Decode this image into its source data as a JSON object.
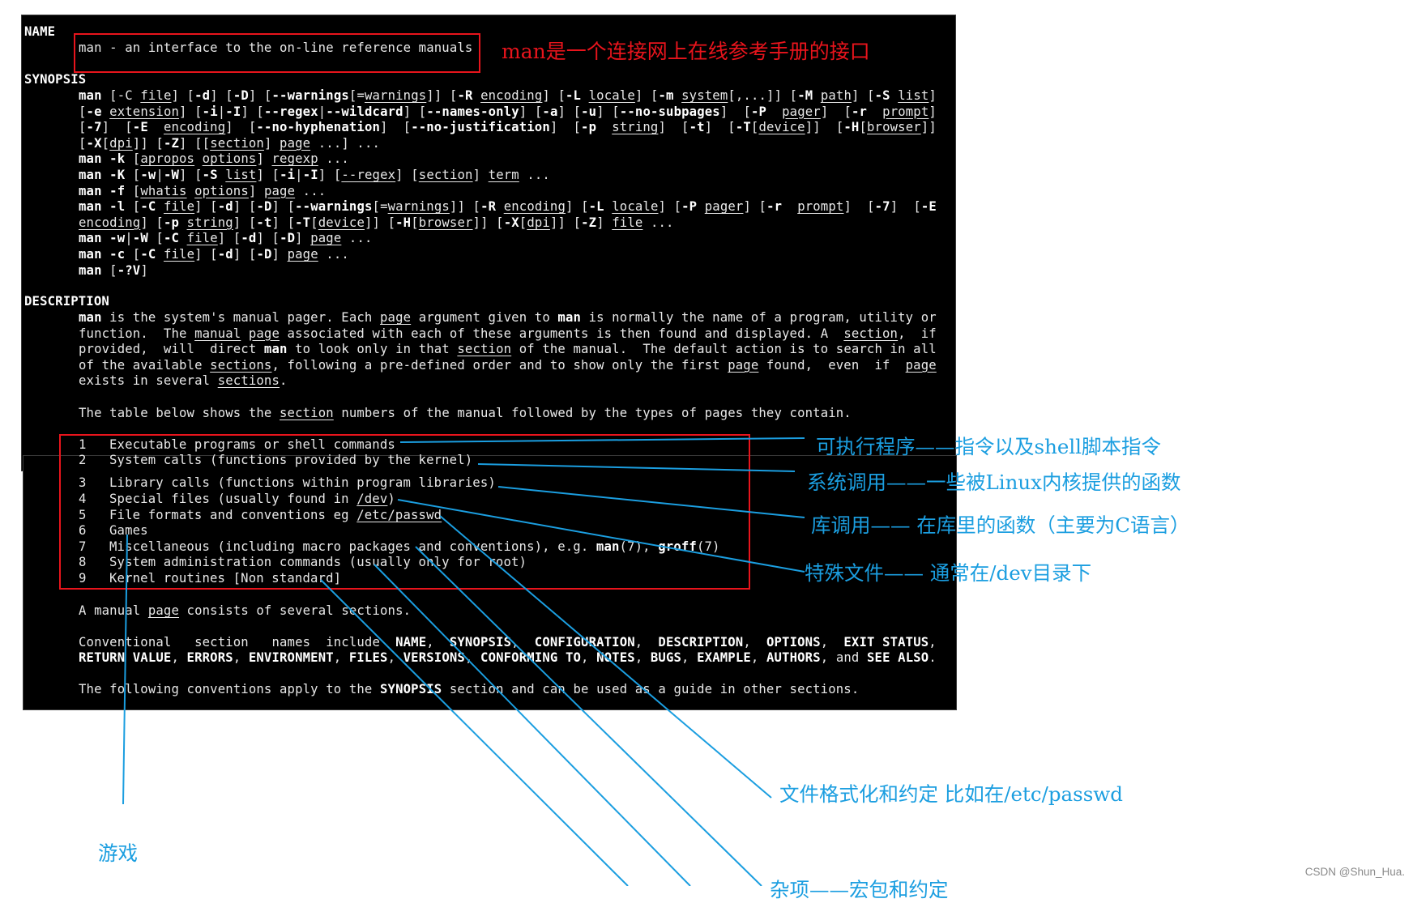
{
  "man_page": {
    "name_header": "NAME",
    "name_line": "man - an interface to the on-line reference manuals",
    "synopsis_header": "SYNOPSIS",
    "synopsis_lines": [
      [
        [
          "b",
          "man"
        ],
        [
          "t",
          " [-C "
        ],
        [
          "u",
          "file"
        ],
        [
          "t",
          "] ["
        ],
        [
          "b",
          "-d"
        ],
        [
          "t",
          "] ["
        ],
        [
          "b",
          "-D"
        ],
        [
          "t",
          "] ["
        ],
        [
          "b",
          "--warnings"
        ],
        [
          "t",
          "[="
        ],
        [
          "u",
          "warnings"
        ],
        [
          "t",
          "]] ["
        ],
        [
          "b",
          "-R"
        ],
        [
          "t",
          " "
        ],
        [
          "u",
          "encoding"
        ],
        [
          "t",
          "] ["
        ],
        [
          "b",
          "-L"
        ],
        [
          "t",
          " "
        ],
        [
          "u",
          "locale"
        ],
        [
          "t",
          "] ["
        ],
        [
          "b",
          "-m"
        ],
        [
          "t",
          " "
        ],
        [
          "u",
          "system"
        ],
        [
          "t",
          "[,...]] ["
        ],
        [
          "b",
          "-M"
        ],
        [
          "t",
          " "
        ],
        [
          "u",
          "path"
        ],
        [
          "t",
          "] ["
        ],
        [
          "b",
          "-S"
        ],
        [
          "t",
          " "
        ],
        [
          "u",
          "list"
        ],
        [
          "t",
          "]"
        ]
      ],
      [
        [
          "t",
          "["
        ],
        [
          "b",
          "-e"
        ],
        [
          "t",
          " "
        ],
        [
          "u",
          "extension"
        ],
        [
          "t",
          "] ["
        ],
        [
          "b",
          "-i"
        ],
        [
          "t",
          "|"
        ],
        [
          "b",
          "-I"
        ],
        [
          "t",
          "] ["
        ],
        [
          "b",
          "--regex"
        ],
        [
          "t",
          "|"
        ],
        [
          "b",
          "--wildcard"
        ],
        [
          "t",
          "] ["
        ],
        [
          "b",
          "--names-only"
        ],
        [
          "t",
          "] ["
        ],
        [
          "b",
          "-a"
        ],
        [
          "t",
          "] ["
        ],
        [
          "b",
          "-u"
        ],
        [
          "t",
          "] ["
        ],
        [
          "b",
          "--no-subpages"
        ],
        [
          "t",
          "]  ["
        ],
        [
          "b",
          "-P"
        ],
        [
          "t",
          "  "
        ],
        [
          "u",
          "pager"
        ],
        [
          "t",
          "]  ["
        ],
        [
          "b",
          "-r"
        ],
        [
          "t",
          "  "
        ],
        [
          "u",
          "prompt"
        ],
        [
          "t",
          "]"
        ]
      ],
      [
        [
          "t",
          "["
        ],
        [
          "b",
          "-7"
        ],
        [
          "t",
          "]  ["
        ],
        [
          "b",
          "-E"
        ],
        [
          "t",
          "  "
        ],
        [
          "u",
          "encoding"
        ],
        [
          "t",
          "]  ["
        ],
        [
          "b",
          "--no-hyphenation"
        ],
        [
          "t",
          "]  ["
        ],
        [
          "b",
          "--no-justification"
        ],
        [
          "t",
          "]  ["
        ],
        [
          "b",
          "-p"
        ],
        [
          "t",
          "  "
        ],
        [
          "u",
          "string"
        ],
        [
          "t",
          "]  ["
        ],
        [
          "b",
          "-t"
        ],
        [
          "t",
          "]  ["
        ],
        [
          "b",
          "-T"
        ],
        [
          "t",
          "["
        ],
        [
          "u",
          "device"
        ],
        [
          "t",
          "]]  ["
        ],
        [
          "b",
          "-H"
        ],
        [
          "t",
          "["
        ],
        [
          "u",
          "browser"
        ],
        [
          "t",
          "]]"
        ]
      ],
      [
        [
          "t",
          "["
        ],
        [
          "b",
          "-X"
        ],
        [
          "t",
          "["
        ],
        [
          "u",
          "dpi"
        ],
        [
          "t",
          "]] ["
        ],
        [
          "b",
          "-Z"
        ],
        [
          "t",
          "] [["
        ],
        [
          "u",
          "section"
        ],
        [
          "t",
          "] "
        ],
        [
          "u",
          "page"
        ],
        [
          "t",
          " ...] ..."
        ]
      ],
      [
        [
          "b",
          "man"
        ],
        [
          "t",
          " "
        ],
        [
          "b",
          "-k"
        ],
        [
          "t",
          " ["
        ],
        [
          "u",
          "apropos"
        ],
        [
          "t",
          " "
        ],
        [
          "u",
          "options"
        ],
        [
          "t",
          "] "
        ],
        [
          "u",
          "regexp"
        ],
        [
          "t",
          " ..."
        ]
      ],
      [
        [
          "b",
          "man"
        ],
        [
          "t",
          " "
        ],
        [
          "b",
          "-K"
        ],
        [
          "t",
          " ["
        ],
        [
          "b",
          "-w"
        ],
        [
          "t",
          "|"
        ],
        [
          "b",
          "-W"
        ],
        [
          "t",
          "] ["
        ],
        [
          "b",
          "-S"
        ],
        [
          "t",
          " "
        ],
        [
          "u",
          "list"
        ],
        [
          "t",
          "] ["
        ],
        [
          "b",
          "-i"
        ],
        [
          "t",
          "|"
        ],
        [
          "b",
          "-I"
        ],
        [
          "t",
          "] ["
        ],
        [
          "u",
          "--regex"
        ],
        [
          "t",
          "] ["
        ],
        [
          "u",
          "section"
        ],
        [
          "t",
          "] "
        ],
        [
          "u",
          "term"
        ],
        [
          "t",
          " ..."
        ]
      ],
      [
        [
          "b",
          "man"
        ],
        [
          "t",
          " "
        ],
        [
          "b",
          "-f"
        ],
        [
          "t",
          " ["
        ],
        [
          "u",
          "whatis"
        ],
        [
          "t",
          " "
        ],
        [
          "u",
          "options"
        ],
        [
          "t",
          "] "
        ],
        [
          "u",
          "page"
        ],
        [
          "t",
          " ..."
        ]
      ],
      [
        [
          "b",
          "man"
        ],
        [
          "t",
          " "
        ],
        [
          "b",
          "-l"
        ],
        [
          "t",
          " ["
        ],
        [
          "b",
          "-C"
        ],
        [
          "t",
          " "
        ],
        [
          "u",
          "file"
        ],
        [
          "t",
          "] ["
        ],
        [
          "b",
          "-d"
        ],
        [
          "t",
          "] ["
        ],
        [
          "b",
          "-D"
        ],
        [
          "t",
          "] ["
        ],
        [
          "b",
          "--warnings"
        ],
        [
          "t",
          "[="
        ],
        [
          "u",
          "warnings"
        ],
        [
          "t",
          "]] ["
        ],
        [
          "b",
          "-R"
        ],
        [
          "t",
          " "
        ],
        [
          "u",
          "encoding"
        ],
        [
          "t",
          "] ["
        ],
        [
          "b",
          "-L"
        ],
        [
          "t",
          " "
        ],
        [
          "u",
          "locale"
        ],
        [
          "t",
          "] ["
        ],
        [
          "b",
          "-P"
        ],
        [
          "t",
          " "
        ],
        [
          "u",
          "pager"
        ],
        [
          "t",
          "] ["
        ],
        [
          "b",
          "-r"
        ],
        [
          "t",
          "  "
        ],
        [
          "u",
          "prompt"
        ],
        [
          "t",
          "]  ["
        ],
        [
          "b",
          "-7"
        ],
        [
          "t",
          "]  ["
        ],
        [
          "b",
          "-E"
        ]
      ],
      [
        [
          "u",
          "encoding"
        ],
        [
          "t",
          "] ["
        ],
        [
          "b",
          "-p"
        ],
        [
          "t",
          " "
        ],
        [
          "u",
          "string"
        ],
        [
          "t",
          "] ["
        ],
        [
          "b",
          "-t"
        ],
        [
          "t",
          "] ["
        ],
        [
          "b",
          "-T"
        ],
        [
          "t",
          "["
        ],
        [
          "u",
          "device"
        ],
        [
          "t",
          "]] ["
        ],
        [
          "b",
          "-H"
        ],
        [
          "t",
          "["
        ],
        [
          "u",
          "browser"
        ],
        [
          "t",
          "]] ["
        ],
        [
          "b",
          "-X"
        ],
        [
          "t",
          "["
        ],
        [
          "u",
          "dpi"
        ],
        [
          "t",
          "]] ["
        ],
        [
          "b",
          "-Z"
        ],
        [
          "t",
          "] "
        ],
        [
          "u",
          "file"
        ],
        [
          "t",
          " ..."
        ]
      ],
      [
        [
          "b",
          "man"
        ],
        [
          "t",
          " "
        ],
        [
          "b",
          "-w"
        ],
        [
          "t",
          "|"
        ],
        [
          "b",
          "-W"
        ],
        [
          "t",
          " ["
        ],
        [
          "b",
          "-C"
        ],
        [
          "t",
          " "
        ],
        [
          "u",
          "file"
        ],
        [
          "t",
          "] ["
        ],
        [
          "b",
          "-d"
        ],
        [
          "t",
          "] ["
        ],
        [
          "b",
          "-D"
        ],
        [
          "t",
          "] "
        ],
        [
          "u",
          "page"
        ],
        [
          "t",
          " ..."
        ]
      ],
      [
        [
          "b",
          "man"
        ],
        [
          "t",
          " "
        ],
        [
          "b",
          "-c"
        ],
        [
          "t",
          " ["
        ],
        [
          "b",
          "-C"
        ],
        [
          "t",
          " "
        ],
        [
          "u",
          "file"
        ],
        [
          "t",
          "] ["
        ],
        [
          "b",
          "-d"
        ],
        [
          "t",
          "] ["
        ],
        [
          "b",
          "-D"
        ],
        [
          "t",
          "] "
        ],
        [
          "u",
          "page"
        ],
        [
          "t",
          " ..."
        ]
      ],
      [
        [
          "b",
          "man"
        ],
        [
          "t",
          " ["
        ],
        [
          "b",
          "-?V"
        ],
        [
          "t",
          "]"
        ]
      ]
    ],
    "description_header": "DESCRIPTION",
    "description_lines": [
      [
        [
          "b",
          "man"
        ],
        [
          "t",
          " is the system's manual pager. Each "
        ],
        [
          "u",
          "page"
        ],
        [
          "t",
          " argument given to "
        ],
        [
          "b",
          "man"
        ],
        [
          "t",
          " is normally the name of a program, utility or"
        ]
      ],
      [
        [
          "t",
          "function.  The "
        ],
        [
          "u",
          "manual"
        ],
        [
          "t",
          " "
        ],
        [
          "u",
          "page"
        ],
        [
          "t",
          " associated with each of these arguments is then found and displayed. A  "
        ],
        [
          "u",
          "section"
        ],
        [
          "t",
          ",  if"
        ]
      ],
      [
        [
          "t",
          "provided,  will  direct "
        ],
        [
          "b",
          "man"
        ],
        [
          "t",
          " to look only in that "
        ],
        [
          "u",
          "section"
        ],
        [
          "t",
          " of the manual.  The default action is to search in all"
        ]
      ],
      [
        [
          "t",
          "of the available "
        ],
        [
          "u",
          "sections"
        ],
        [
          "t",
          ", following a pre-defined order and to show only the first "
        ],
        [
          "u",
          "page"
        ],
        [
          "t",
          " found,  even  if  "
        ],
        [
          "u",
          "page"
        ]
      ],
      [
        [
          "t",
          "exists in several "
        ],
        [
          "u",
          "sections"
        ],
        [
          "t",
          "."
        ]
      ]
    ],
    "table_intro": [
      [
        "t",
        "The table below shows the "
      ],
      [
        "u",
        "section"
      ],
      [
        "t",
        " numbers of the manual followed by the types of pages they contain."
      ]
    ],
    "sections_table": [
      {
        "num": "1",
        "desc": [
          [
            "t",
            "Executable programs or shell commands"
          ]
        ]
      },
      {
        "num": "2",
        "desc": [
          [
            "t",
            "System calls (functions provided by the kernel)"
          ]
        ]
      },
      {
        "num": "3",
        "desc": [
          [
            "t",
            "Library calls (functions within program libraries)"
          ]
        ]
      },
      {
        "num": "4",
        "desc": [
          [
            "t",
            "Special files (usually found in "
          ],
          [
            "u",
            "/dev"
          ],
          [
            "t",
            ")"
          ]
        ]
      },
      {
        "num": "5",
        "desc": [
          [
            "t",
            "File formats and conventions eg "
          ],
          [
            "u",
            "/etc/passwd"
          ]
        ]
      },
      {
        "num": "6",
        "desc": [
          [
            "t",
            "Games"
          ]
        ]
      },
      {
        "num": "7",
        "desc": [
          [
            "t",
            "Miscellaneous (including macro packages and conventions), e.g. "
          ],
          [
            "b",
            "man"
          ],
          [
            "t",
            "(7), "
          ],
          [
            "b",
            "groff"
          ],
          [
            "t",
            "(7)"
          ]
        ]
      },
      {
        "num": "8",
        "desc": [
          [
            "t",
            "System administration commands (usually only for root)"
          ]
        ]
      },
      {
        "num": "9",
        "desc": [
          [
            "t",
            "Kernel routines [Non standard]"
          ]
        ]
      }
    ],
    "after_table": [
      [
        [
          "t",
          "A manual "
        ],
        [
          "u",
          "page"
        ],
        [
          "t",
          " consists of several sections."
        ]
      ],
      [
        [
          "t",
          "Conventional   section   names  include  "
        ],
        [
          "b",
          "NAME"
        ],
        [
          "t",
          ",  "
        ],
        [
          "b",
          "SYNOPSIS"
        ],
        [
          "t",
          ",  "
        ],
        [
          "b",
          "CONFIGURATION"
        ],
        [
          "t",
          ",  "
        ],
        [
          "b",
          "DESCRIPTION"
        ],
        [
          "t",
          ",  "
        ],
        [
          "b",
          "OPTIONS"
        ],
        [
          "t",
          ",  "
        ],
        [
          "b",
          "EXIT STATUS"
        ],
        [
          "t",
          ","
        ]
      ],
      [
        [
          "b",
          "RETURN VALUE"
        ],
        [
          "t",
          ", "
        ],
        [
          "b",
          "ERRORS"
        ],
        [
          "t",
          ", "
        ],
        [
          "b",
          "ENVIRONMENT"
        ],
        [
          "t",
          ", "
        ],
        [
          "b",
          "FILES"
        ],
        [
          "t",
          ", "
        ],
        [
          "b",
          "VERSIONS"
        ],
        [
          "t",
          ", "
        ],
        [
          "b",
          "CONFORMING TO"
        ],
        [
          "t",
          ", "
        ],
        [
          "b",
          "NOTES"
        ],
        [
          "t",
          ", "
        ],
        [
          "b",
          "BUGS"
        ],
        [
          "t",
          ", "
        ],
        [
          "b",
          "EXAMPLE"
        ],
        [
          "t",
          ", "
        ],
        [
          "b",
          "AUTHORS"
        ],
        [
          "t",
          ", and "
        ],
        [
          "b",
          "SEE ALSO"
        ],
        [
          "t",
          "."
        ]
      ],
      [
        [
          "t",
          "The following conventions apply to the "
        ],
        [
          "b",
          "SYNOPSIS"
        ],
        [
          "t",
          " section and can be used as a guide in other sections."
        ]
      ]
    ]
  },
  "annotations": {
    "name_note": "man是一个连接网上在线参考手册的接口",
    "sec1": "可执行程序——指令以及shell脚本指令",
    "sec2": "系统调用——一些被Linux内核提供的函数",
    "sec3": "库调用—— 在库里的函数（主要为C语言）",
    "sec4": "特殊文件—— 通常在/dev目录下",
    "sec5": "文件格式化和约定 比如在/etc/passwd",
    "sec6": "游戏",
    "sec7": "杂项——宏包和约定"
  },
  "colors": {
    "terminal_bg": "#000000",
    "highlight_box": "#e8141c",
    "annotation_blue": "#1b9ee0",
    "annotation_red": "#e8141c"
  },
  "watermark": "CSDN @Shun_Hua."
}
